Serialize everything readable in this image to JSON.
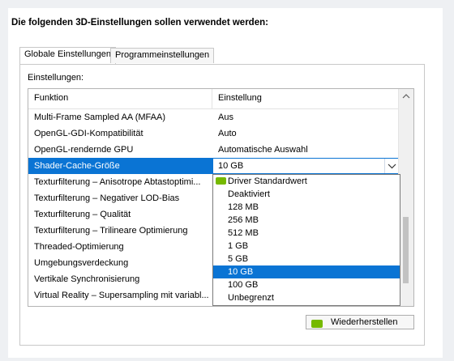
{
  "heading": "Die folgenden 3D-Einstellungen sollen verwendet werden:",
  "tabs": [
    {
      "label": "Globale Einstellungen",
      "active": true
    },
    {
      "label": "Programmeinstellungen",
      "active": false
    }
  ],
  "settings_label": "Einstellungen:",
  "columns": {
    "function": "Funktion",
    "setting": "Einstellung"
  },
  "rows": [
    {
      "function": "Multi-Frame Sampled AA (MFAA)",
      "value": "Aus"
    },
    {
      "function": "OpenGL-GDI-Kompatibilität",
      "value": "Auto"
    },
    {
      "function": "OpenGL-rendernde GPU",
      "value": "Automatische Auswahl"
    },
    {
      "function": "Shader-Cache-Größe",
      "value": "10 GB",
      "selected": true
    },
    {
      "function": "Texturfilterung – Anisotrope Abtastoptimi...",
      "value": ""
    },
    {
      "function": "Texturfilterung – Negativer LOD-Bias",
      "value": ""
    },
    {
      "function": "Texturfilterung – Qualität",
      "value": ""
    },
    {
      "function": "Texturfilterung – Trilineare Optimierung",
      "value": ""
    },
    {
      "function": "Threaded-Optimierung",
      "value": ""
    },
    {
      "function": "Umgebungsverdeckung",
      "value": ""
    },
    {
      "function": "Vertikale Synchronisierung",
      "value": ""
    },
    {
      "function": "Virtual Reality – Supersampling mit variabl...",
      "value": ""
    }
  ],
  "dropdown": {
    "options": [
      {
        "label": "Driver Standardwert",
        "icon": "nvidia-icon"
      },
      {
        "label": "Deaktiviert"
      },
      {
        "label": "128 MB"
      },
      {
        "label": "256 MB"
      },
      {
        "label": "512 MB"
      },
      {
        "label": "1 GB"
      },
      {
        "label": "5 GB"
      },
      {
        "label": "10 GB",
        "selected": true
      },
      {
        "label": "100 GB"
      },
      {
        "label": "Unbegrenzt"
      }
    ]
  },
  "restore_button": {
    "label": "Wiederherstellen",
    "icon": "nvidia-icon"
  },
  "colors": {
    "selection": "#0a74d4",
    "nvidia_green": "#76b900"
  }
}
